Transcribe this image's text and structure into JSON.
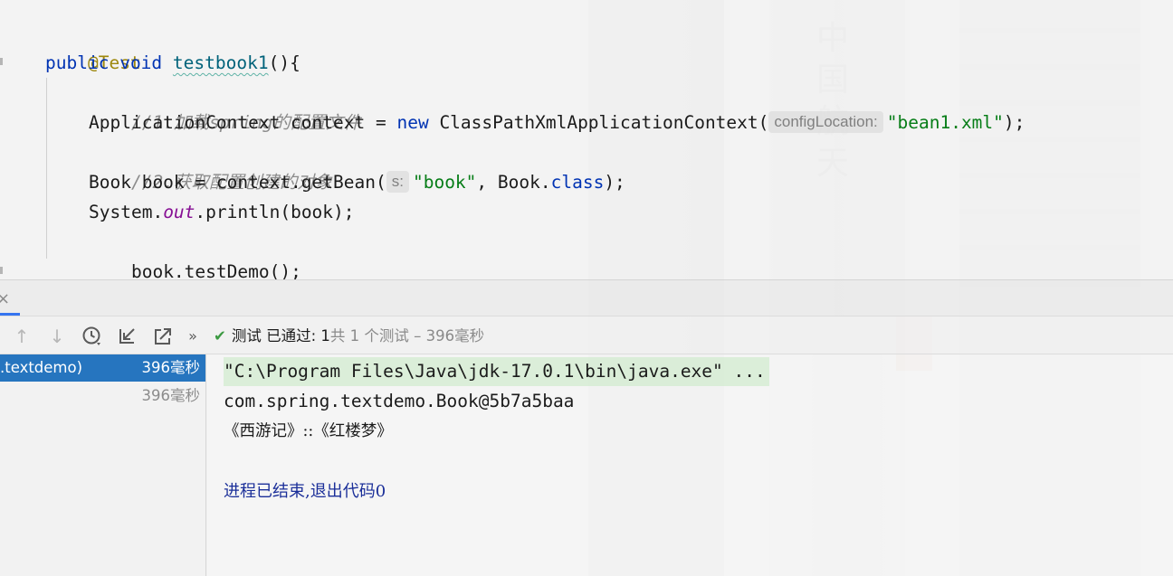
{
  "editor": {
    "lines": {
      "annotation": "@Test",
      "method_sig": {
        "kw1": "public",
        "kw2": "void",
        "name": "testbook1",
        "rest": "(){"
      },
      "comment1": "//1.加载spring的配置文件",
      "line_ctx": {
        "decl": "ApplicationContext context = ",
        "kw_new": "new",
        "ctor": " ClassPathXmlApplicationContext(",
        "hint": "configLocation:",
        "arg": "\"bean1.xml\"",
        "end": ");"
      },
      "comment2": "//2.获取配置创建的对象",
      "line_getbean": {
        "pre": "Book book = context.getBean(",
        "hint": "s:",
        "arg": "\"book\"",
        "mid": ", Book.",
        "kw_class": "class",
        "end": ");"
      },
      "line_println": {
        "pre": "System.",
        "field": "out",
        "post": ".println(book);"
      },
      "line_testdemo": "book.testDemo();",
      "closing": "}"
    }
  },
  "toolwindow": {
    "close_icon": "×",
    "toolbar": {
      "up_icon": "↑",
      "down_icon": "↓",
      "history_icon": "history-clock",
      "import_icon": "↙",
      "export_icon": "↗",
      "more_icon": "»",
      "status_check": "✔",
      "status_passed": "测试 已通过: 1",
      "status_total": "共 1 个测试 – 396毫秒"
    },
    "tree": [
      {
        "name": ".textdemo)",
        "time": "396毫秒",
        "selected": true
      },
      {
        "name": "",
        "time": "396毫秒",
        "selected": false
      }
    ],
    "console": {
      "cmd": "\"C:\\Program Files\\Java\\jdk-17.0.1\\bin\\java.exe\" ...",
      "out1": "com.spring.textdemo.Book@5b7a5baa",
      "out2": "《西游记》::《红楼梦》",
      "exit": "进程已结束,退出代码0"
    }
  },
  "background": {
    "glyphs": "中国航天"
  },
  "colors": {
    "keyword": "#0033b3",
    "string": "#067d17",
    "comment": "#8c8c8c",
    "annotation": "#9e880d",
    "selection": "#2675bf",
    "pass_check": "#3c9a42"
  }
}
